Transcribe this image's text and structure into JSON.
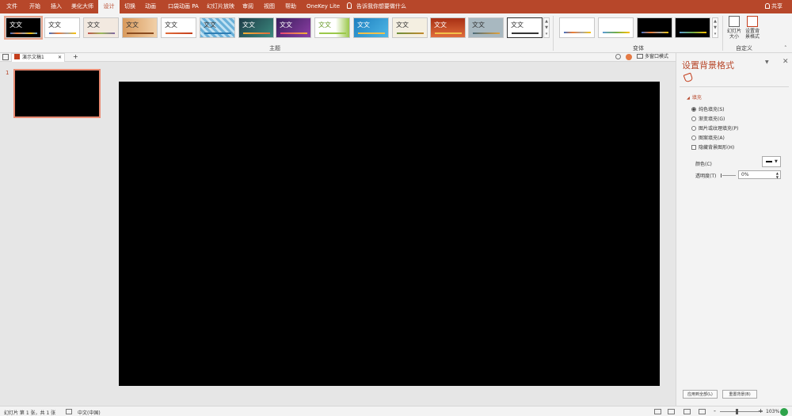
{
  "menu": {
    "tabs": [
      "文件",
      "开始",
      "插入",
      "美化大师",
      "设计",
      "切换",
      "动画",
      "口袋动画 PA",
      "幻灯片放映",
      "审阅",
      "视图",
      "帮助",
      "OneKey Lite"
    ],
    "active_tab": "设计",
    "tell_me": "告诉我你想要做什么",
    "share": "共享"
  },
  "ribbon": {
    "themes_group_label": "主题",
    "variants_group_label": "变体",
    "customize_group_label": "自定义",
    "theme_sample_text": "文文",
    "slide_size_label": "幻灯片大小",
    "format_background_label": "设置背景格式"
  },
  "document": {
    "tab_title": "演示文稿1",
    "multi_window": "多窗口模式"
  },
  "thumbnails": {
    "slide_number": "1"
  },
  "format_pane": {
    "title": "设置背景格式",
    "section": "填充",
    "options": [
      "纯色填充(S)",
      "渐变填充(G)",
      "图片或纹理填充(P)",
      "图案填充(A)"
    ],
    "selected_option": "纯色填充(S)",
    "hide_graphics": "隐藏背景图形(H)",
    "color_label": "颜色(C)",
    "transparency_label": "透明度(T)",
    "transparency_value": "0%",
    "apply_all": "应用到全部(L)",
    "reset": "重置背景(B)"
  },
  "status": {
    "slide_info": "幻灯片 第 1 张，共 1 张",
    "language": "中文(中国)",
    "zoom": "103%"
  },
  "colors": {
    "accent": "#b7472a",
    "slide_background": "#000000"
  }
}
